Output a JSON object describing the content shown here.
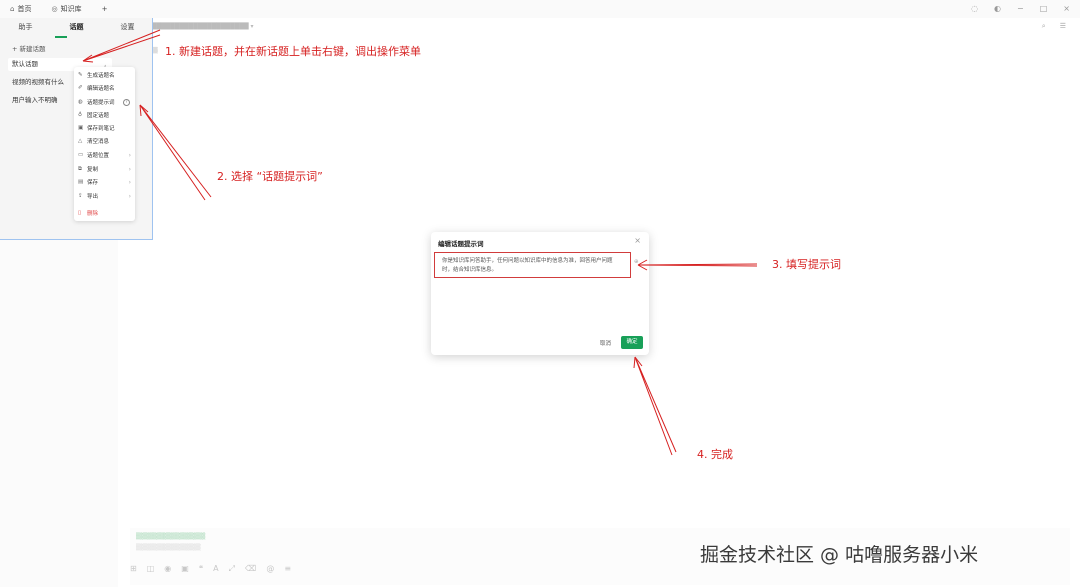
{
  "top_tabs": [
    {
      "icon": "home-icon",
      "glyph": "⌂",
      "label": "首页"
    },
    {
      "icon": "knowledge-base-icon",
      "glyph": "◎",
      "label": "知识库"
    }
  ],
  "add_tab": "+",
  "sub_tabs": [
    "助手",
    "话题",
    "设置"
  ],
  "new_topic": "+ 新建话题",
  "topics": [
    "默认话题",
    "视频的视频有什么",
    "用户输入不明确"
  ],
  "context_menu": [
    {
      "icon": "magic-wand-icon",
      "glyph": "✎",
      "label": "生成话题名",
      "arrow": ""
    },
    {
      "icon": "pencil-icon",
      "glyph": "✐",
      "label": "编辑话题名",
      "arrow": ""
    },
    {
      "icon": "prompt-icon",
      "glyph": "◍",
      "label": "话题提示词",
      "arrow": ""
    },
    {
      "icon": "pin-icon",
      "glyph": "♁",
      "label": "固定话题",
      "arrow": ""
    },
    {
      "icon": "note-icon",
      "glyph": "▣",
      "label": "保存到笔记",
      "arrow": ""
    },
    {
      "icon": "clear-icon",
      "glyph": "△",
      "label": "清空消息",
      "arrow": ""
    },
    {
      "icon": "folder-icon",
      "glyph": "▭",
      "label": "话题位置",
      "arrow": "›"
    },
    {
      "icon": "copy-icon",
      "glyph": "⧉",
      "label": "复制",
      "arrow": "›"
    },
    {
      "icon": "save-icon",
      "glyph": "▤",
      "label": "保存",
      "arrow": "›"
    },
    {
      "icon": "export-icon",
      "glyph": "⇪",
      "label": "导出",
      "arrow": "›"
    },
    {
      "icon": "trash-icon",
      "glyph": "▯",
      "label": "删除",
      "arrow": ""
    }
  ],
  "dialog": {
    "title": "编辑话题提示词",
    "close": "×",
    "prompt_text": "你是知识库问答助手，任何问题以知识库中的信息为准，回答用户问题时，结合知识库信息。",
    "expand": "⊕",
    "cancel": "取消",
    "ok": "确定"
  },
  "annotations": {
    "step1": "1. 新建话题，并在新话题上单击右键，调出操作菜单",
    "step2": "2. 选择 “话题提示词”",
    "step3": "3. 填写提示词",
    "step4": "4. 完成"
  },
  "watermark": "掘金技术社区 @ 咕噜服务器小米",
  "colors": {
    "accent": "#18a058",
    "annotation": "#d62020",
    "panel_border": "#9fc3f0"
  }
}
